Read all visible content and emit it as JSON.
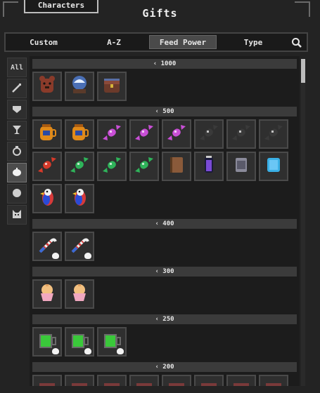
{
  "window": {
    "characters_tab": "Characters",
    "title": "Gifts"
  },
  "sort_tabs": [
    {
      "label": "Custom",
      "active": false
    },
    {
      "label": "A-Z",
      "active": false
    },
    {
      "label": "Feed Power",
      "active": true
    },
    {
      "label": "Type",
      "active": false
    }
  ],
  "categories": [
    {
      "id": "all",
      "label": "All",
      "icon": "all-text",
      "active": false
    },
    {
      "id": "tools",
      "label": "",
      "icon": "wand-icon",
      "active": false
    },
    {
      "id": "gems",
      "label": "",
      "icon": "gem-icon",
      "active": false
    },
    {
      "id": "drinks",
      "label": "",
      "icon": "goblet-icon",
      "active": false
    },
    {
      "id": "rings",
      "label": "",
      "icon": "ring-icon",
      "active": false
    },
    {
      "id": "food",
      "label": "",
      "icon": "food-icon",
      "active": true
    },
    {
      "id": "minerals",
      "label": "",
      "icon": "ore-icon",
      "active": false
    },
    {
      "id": "creatures",
      "label": "",
      "icon": "cat-icon",
      "active": false
    }
  ],
  "sections": [
    {
      "label": "‹ 1000",
      "items": [
        {
          "icon": "bear-plush-icon",
          "color": "#8a3b2a",
          "badge": false
        },
        {
          "icon": "snow-globe-icon",
          "color": "#4a6fb5",
          "badge": false
        },
        {
          "icon": "treasure-chest-icon",
          "color": "#6b3a2a",
          "badge": false
        }
      ]
    },
    {
      "label": "‹ 500",
      "items": [
        {
          "icon": "amber-jar-icon",
          "color": "#e08a1a",
          "badge": false
        },
        {
          "icon": "amber-jar-icon",
          "color": "#e08a1a",
          "badge": false
        },
        {
          "icon": "candy-icon",
          "color": "#c94fd6",
          "badge": false
        },
        {
          "icon": "candy-icon",
          "color": "#c94fd6",
          "badge": false
        },
        {
          "icon": "candy-icon",
          "color": "#c94fd6",
          "badge": false
        },
        {
          "icon": "candy-icon",
          "color": "#3a3a3a",
          "badge": false
        },
        {
          "icon": "candy-icon",
          "color": "#3a3a3a",
          "badge": false
        },
        {
          "icon": "candy-icon",
          "color": "#3a3a3a",
          "badge": false
        },
        {
          "icon": "candy-icon",
          "color": "#d63a2a",
          "badge": false
        },
        {
          "icon": "candy-icon",
          "color": "#2fb35a",
          "badge": false
        },
        {
          "icon": "candy-icon",
          "color": "#2fb35a",
          "badge": false
        },
        {
          "icon": "candy-icon",
          "color": "#2fb35a",
          "badge": false
        },
        {
          "icon": "book-icon",
          "color": "#8a5a3a",
          "badge": false
        },
        {
          "icon": "potion-icon",
          "color": "#7a4ad6",
          "badge": false
        },
        {
          "icon": "tin-can-icon",
          "color": "#8a8a9a",
          "badge": false
        },
        {
          "icon": "ice-cube-icon",
          "color": "#3ab0e6",
          "badge": false
        },
        {
          "icon": "parrot-icon",
          "color": "#d63a3a",
          "badge": false
        },
        {
          "icon": "parrot-icon",
          "color": "#d63a3a",
          "badge": false
        }
      ]
    },
    {
      "label": "‹ 400",
      "items": [
        {
          "icon": "cane-icon",
          "color": "#d63a3a",
          "badge": true
        },
        {
          "icon": "cane-icon",
          "color": "#d63a3a",
          "badge": true
        }
      ]
    },
    {
      "label": "‹ 300",
      "items": [
        {
          "icon": "cupcake-icon",
          "color": "#f0a8c0",
          "badge": false
        },
        {
          "icon": "cupcake-icon",
          "color": "#f0a8c0",
          "badge": false
        }
      ]
    },
    {
      "label": "‹ 250",
      "items": [
        {
          "icon": "green-mug-icon",
          "color": "#3ac83a",
          "badge": true
        },
        {
          "icon": "green-mug-icon",
          "color": "#3ac83a",
          "badge": true
        },
        {
          "icon": "green-mug-icon",
          "color": "#3ac83a",
          "badge": true
        }
      ]
    },
    {
      "label": "‹ 200",
      "items": [
        {
          "icon": "crate-icon",
          "color": "#5a2a2a",
          "badge": false
        },
        {
          "icon": "crate-icon",
          "color": "#5a2a2a",
          "badge": false
        },
        {
          "icon": "crate-icon",
          "color": "#5a2a2a",
          "badge": false
        },
        {
          "icon": "crate-icon",
          "color": "#5a2a2a",
          "badge": false
        },
        {
          "icon": "crate-icon",
          "color": "#5a2a2a",
          "badge": false
        },
        {
          "icon": "crate-icon",
          "color": "#5a2a2a",
          "badge": false
        },
        {
          "icon": "crate-icon",
          "color": "#5a2a2a",
          "badge": false
        },
        {
          "icon": "crate-icon",
          "color": "#5a2a2a",
          "badge": false
        }
      ]
    }
  ]
}
